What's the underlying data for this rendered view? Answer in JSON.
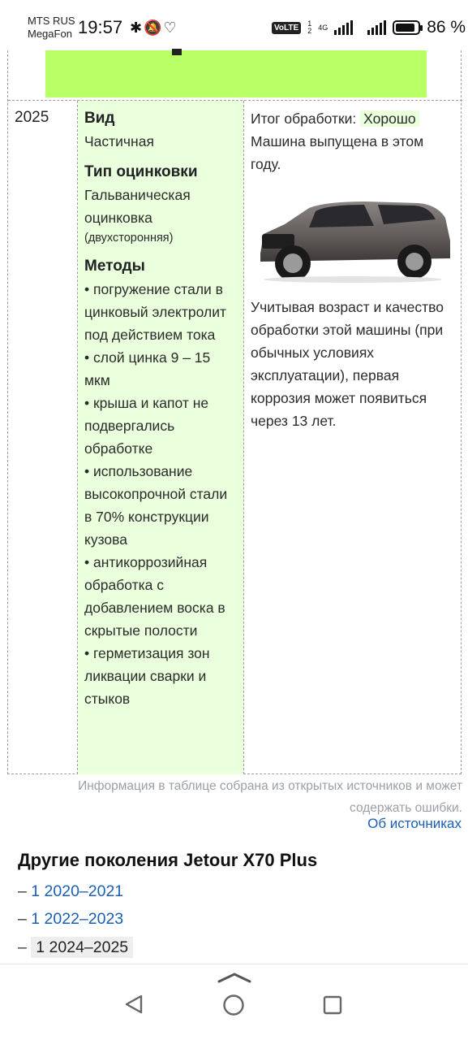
{
  "status_bar": {
    "carrier_1": "MTS RUS",
    "carrier_2": "MegaFon",
    "time": "19:57",
    "network": "4G",
    "battery_percent": "86 %",
    "battery_level": 0.86
  },
  "table": {
    "year": "2025",
    "info": {
      "type_heading": "Вид",
      "type_value": "Частичная",
      "galv_heading": "Тип оцинковки",
      "galv_value": "Гальваническая оцинковка",
      "galv_note": "(двухсторонняя)",
      "methods_heading": "Методы",
      "methods": [
        "• погружение стали в цинковый электролит под действием тока",
        "• слой цинка 9 – 15 мкм",
        "• крыша и капот не подвергались обработке",
        "• использование высокопрочной стали в 70% конструкции кузова",
        "• антикоррозийная обработка с добавлением воска в скрытые полости",
        "• герметизация зон ликвации сварки и стыков"
      ]
    },
    "result": {
      "label": "Итог обработки:",
      "rating": "Хорошо",
      "released_note": "Машина выпущена в этом году.",
      "forecast": "Учитывая возраст и качество обработки этой машины (при обычных условиях эксплуатации), первая коррозия может появиться через 13 лет."
    }
  },
  "footnote": "Информация в таблице собрана из открытых источников и может содержать ошибки.",
  "sources_link": "Об источниках",
  "generations": {
    "title": "Другие поколения Jetour X70 Plus",
    "dash": "–",
    "items": [
      {
        "label": "1 2020–2021",
        "current": false
      },
      {
        "label": "1 2022–2023",
        "current": false
      },
      {
        "label": "1 2024–2025",
        "current": true
      }
    ]
  },
  "colors": {
    "highlight_green": "#b9ff66",
    "info_bg": "#eaffdc",
    "link": "#1a5fb4"
  }
}
